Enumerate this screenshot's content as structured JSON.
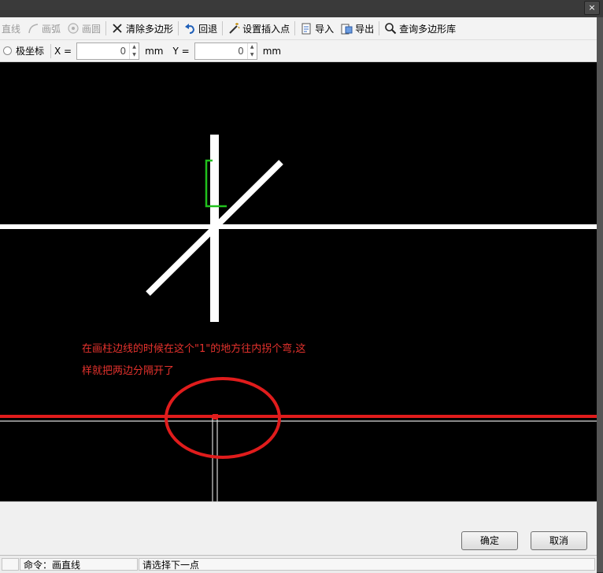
{
  "toolbar": {
    "line": "直线",
    "arc": "画弧",
    "circle": "画圆",
    "clear_polygon": "清除多边形",
    "undo": "回退",
    "set_insert_point": "设置插入点",
    "import": "导入",
    "export": "导出",
    "query_library": "查询多边形库"
  },
  "coords": {
    "polar_label": "极坐标",
    "x_label": "X =",
    "x_value": "0",
    "y_label": "Y =",
    "y_value": "0",
    "unit": "mm"
  },
  "annotation": {
    "line1": "在画柱边线的时候在这个\"1\"的地方往内拐个弯,这",
    "line2": "样就把两边分隔开了"
  },
  "buttons": {
    "ok": "确定",
    "cancel": "取消"
  },
  "status": {
    "command": "命令：画直线",
    "prompt": "请选择下一点"
  },
  "colors": {
    "canvas": "#000000",
    "drawn_line": "#ffffff",
    "marker": "#21c11d",
    "annotation": "#e5322d"
  },
  "window": {
    "close_glyph": "×"
  }
}
